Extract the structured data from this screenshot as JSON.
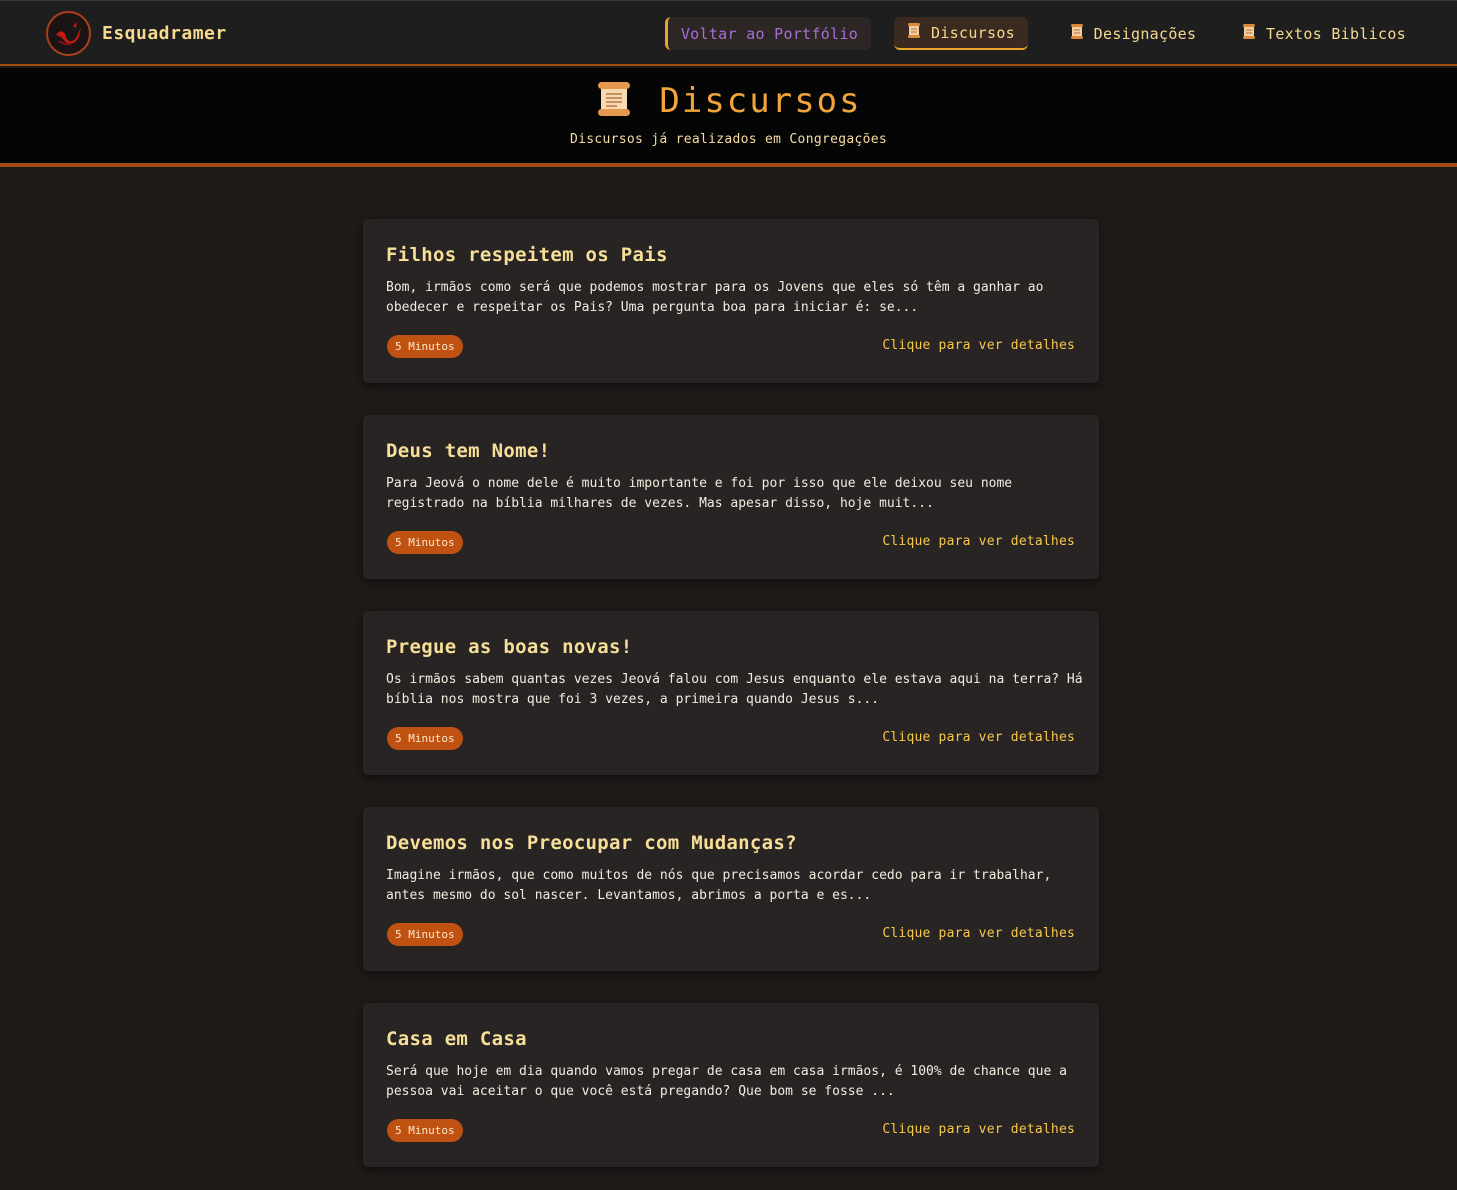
{
  "navbar": {
    "brand": "Esquadramer",
    "logo_icon": "dragon-logo-icon",
    "back_label": "Voltar ao Portfólio",
    "links": [
      {
        "label": "Discursos",
        "icon": "scroll-icon",
        "active": true
      },
      {
        "label": "Designações",
        "icon": "scroll-icon",
        "active": false
      },
      {
        "label": "Textos Biblicos",
        "icon": "scroll-icon",
        "active": false
      }
    ]
  },
  "header": {
    "title": "Discursos",
    "icon": "scroll-icon",
    "subtitle": "Discursos já realizados em Congregações"
  },
  "cards": [
    {
      "title": "Filhos respeitem os Pais",
      "excerpt": "Bom, irmãos como será que podemos mostrar para os Jovens que eles só têm a ganhar ao obedecer e respeitar os Pais? Uma pergunta boa para iniciar é: se...",
      "duration": "5 Minutos",
      "link": "Clique para ver detalhes"
    },
    {
      "title": "Deus tem Nome!",
      "excerpt": "Para Jeová o nome dele é muito importante e foi por isso que ele deixou seu nome registrado na bíblia milhares de vezes. Mas apesar disso, hoje muit...",
      "duration": "5 Minutos",
      "link": "Clique para ver detalhes"
    },
    {
      "title": "Pregue as boas novas!",
      "excerpt": "Os irmãos sabem quantas vezes Jeová falou com Jesus enquanto ele estava aqui na terra? Há bíblia nos mostra que foi 3 vezes, a primeira quando Jesus s...",
      "duration": "5 Minutos",
      "link": "Clique para ver detalhes"
    },
    {
      "title": "Devemos nos Preocupar com Mudanças?",
      "excerpt": "Imagine irmãos, que como muitos de nós que precisamos acordar cedo para ir trabalhar, antes mesmo do sol nascer. Levantamos, abrimos a porta e es...",
      "duration": "5 Minutos",
      "link": "Clique para ver detalhes"
    },
    {
      "title": "Casa em Casa",
      "excerpt": "Será que hoje em dia quando vamos pregar de casa em casa irmãos, é 100% de chance que a pessoa vai aceitar o que você está pregando? Que bom se fosse ...",
      "duration": "5 Minutos",
      "link": "Clique para ver detalhes"
    }
  ],
  "colors": {
    "accent": "#f0a43b",
    "badge": "#bf5210",
    "background": "#1d1a18",
    "card": "#272423"
  }
}
